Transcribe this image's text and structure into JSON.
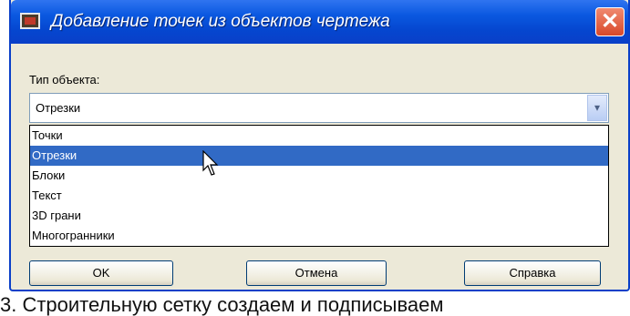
{
  "dialog": {
    "title": "Добавление точек из объектов чертежа",
    "close_glyph": "✕"
  },
  "form": {
    "object_type_label": "Тип объекта:",
    "selected_value": "Отрезки",
    "arrow_glyph": "▾",
    "options": [
      {
        "label": "Точки",
        "selected": false
      },
      {
        "label": "Отрезки",
        "selected": true
      },
      {
        "label": "Блоки",
        "selected": false
      },
      {
        "label": "Текст",
        "selected": false
      },
      {
        "label": "3D грани",
        "selected": false
      },
      {
        "label": "Многогранники",
        "selected": false
      }
    ]
  },
  "buttons": {
    "ok": "OK",
    "cancel": "Отмена",
    "help": "Справка"
  },
  "caption": {
    "text": "3. Строительную сетку создаем и подписываем"
  },
  "colors": {
    "titlebar": "#0a58e0",
    "selection": "#316ac5",
    "close": "#d9482a",
    "dialog_bg": "#ece9d8"
  },
  "icons": {
    "app": "app-icon",
    "close": "close-icon",
    "dropdown": "chevron-down-icon",
    "cursor": "mouse-pointer-icon"
  }
}
